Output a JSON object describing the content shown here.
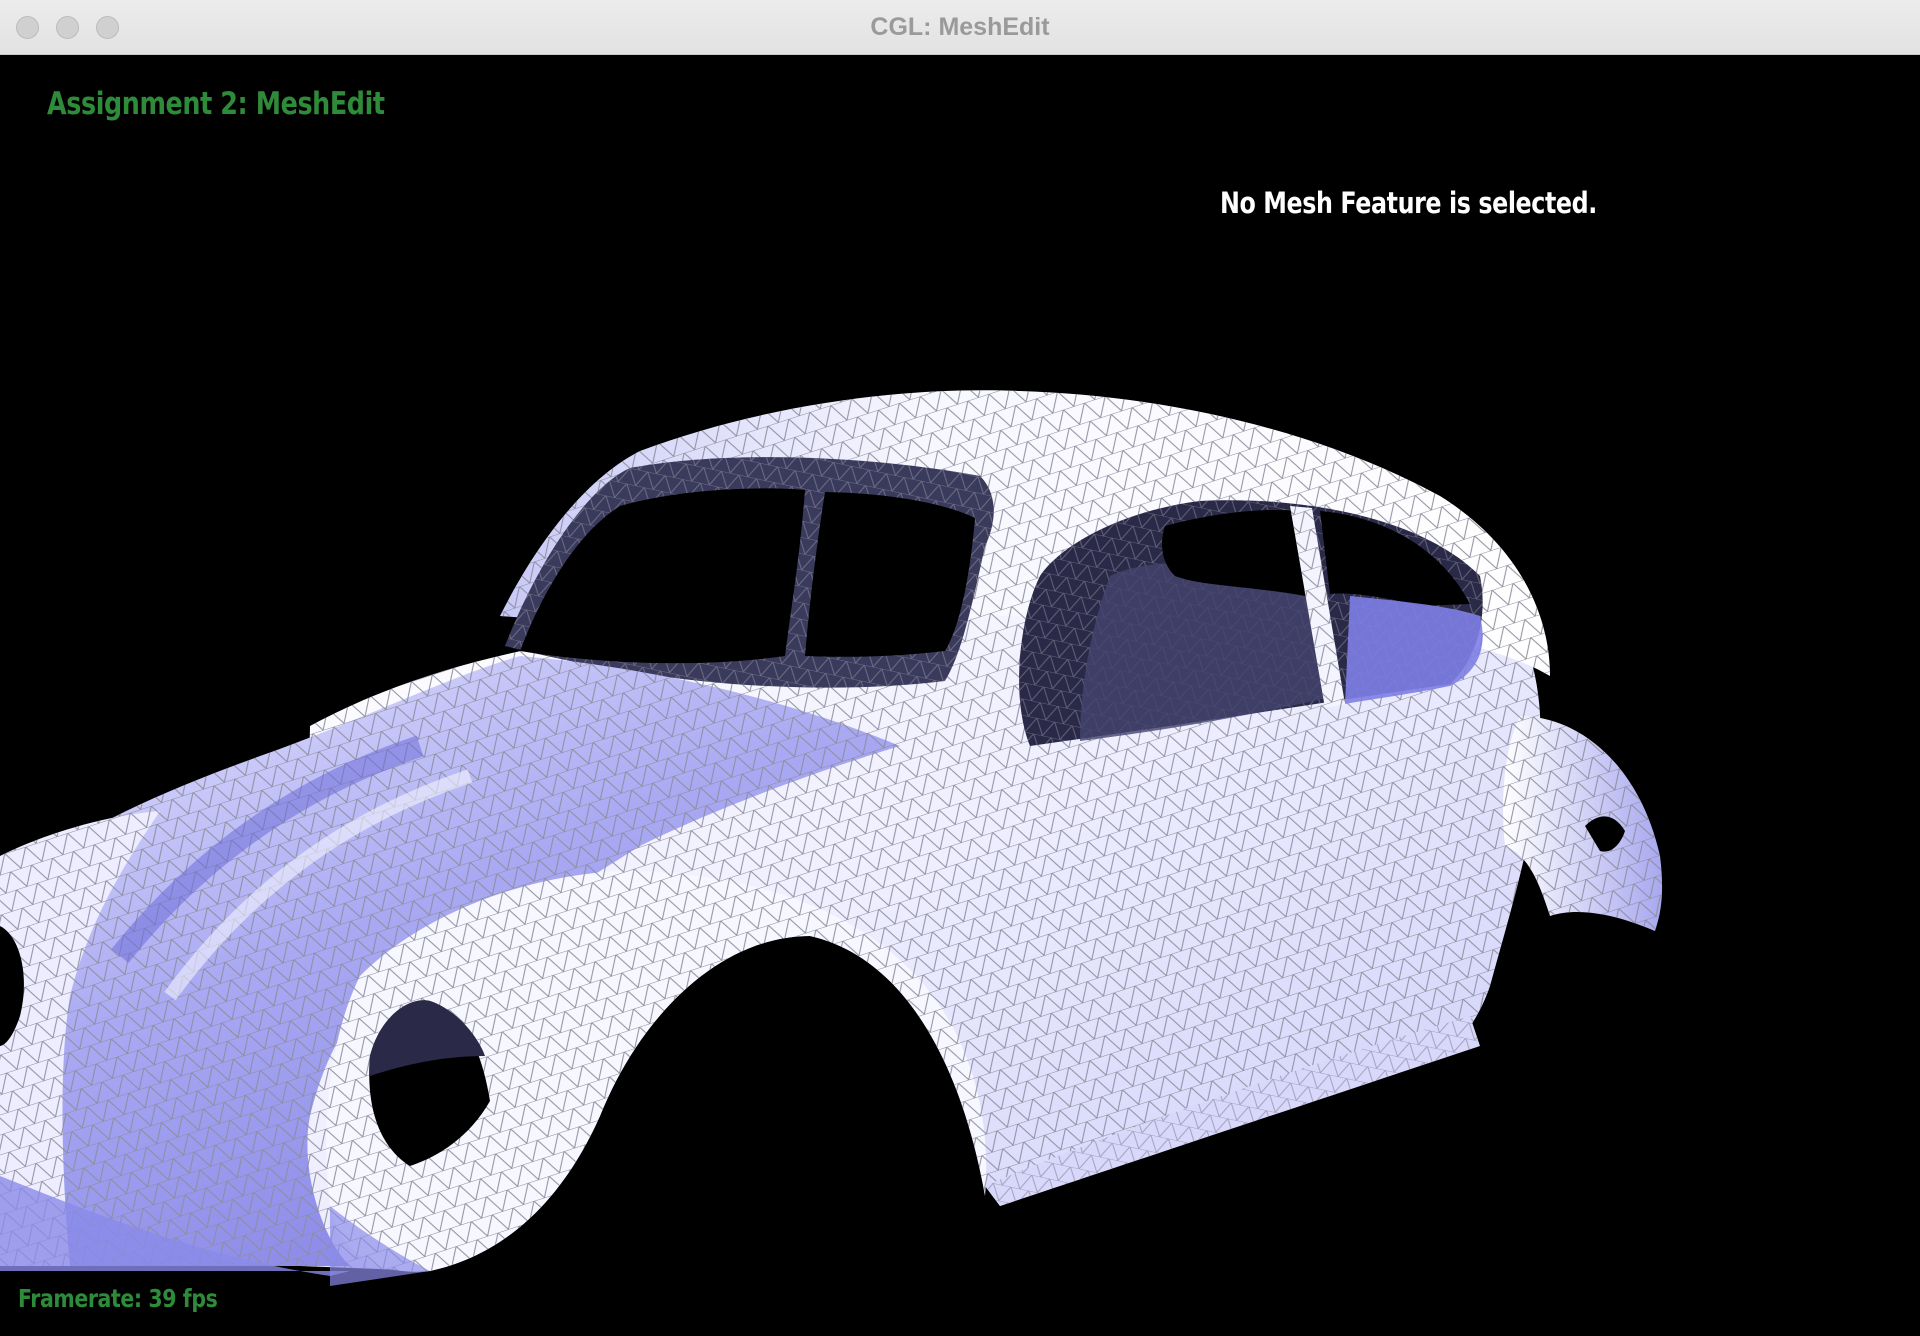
{
  "window": {
    "title": "CGL: MeshEdit"
  },
  "hud": {
    "assignment_title": "Assignment 2: MeshEdit",
    "selection_status": "No Mesh Feature is selected.",
    "framerate": "Framerate: 39 fps"
  },
  "colors": {
    "hud_green": "#2e8b3a",
    "hud_white": "#ffffff",
    "mesh_light": "#f3f3ff",
    "mesh_mid": "#b8b8f5",
    "mesh_shadow": "#8a8ae8",
    "mesh_interior": "#2a2a48",
    "wireframe": "#8c8c9c",
    "background": "#000000"
  },
  "viewport": {
    "model": "car-body-mesh"
  }
}
